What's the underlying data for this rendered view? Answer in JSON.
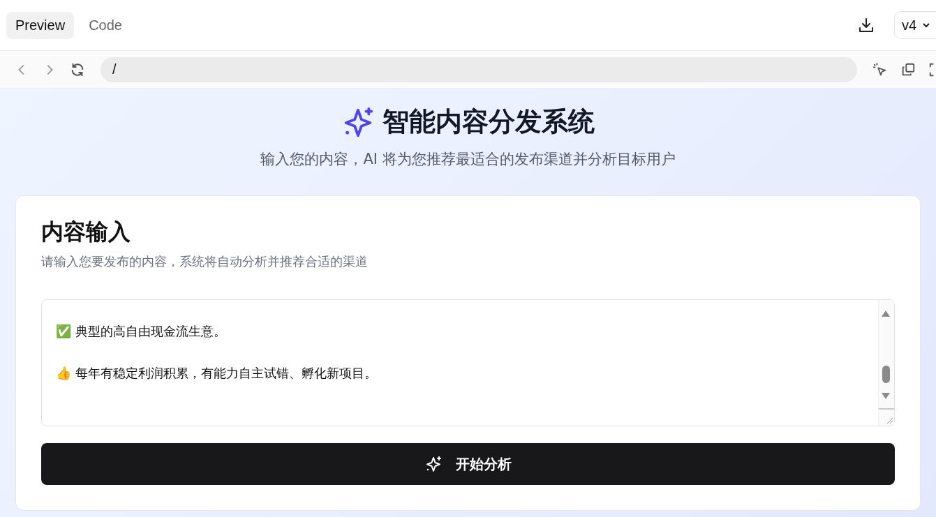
{
  "tabs": [
    {
      "label": "Preview",
      "selected": true
    },
    {
      "label": "Code",
      "selected": false
    }
  ],
  "version": {
    "value": "v4"
  },
  "address_bar": {
    "value": "/"
  },
  "header": {
    "title": "智能内容分发系统",
    "subtitle": "输入您的内容，AI 将为您推荐最适合的发布渠道并分析目标用户"
  },
  "card": {
    "title": "内容输入",
    "description": "请输入您要发布的内容，系统将自动分析并推荐合适的渠道",
    "content_lines": [
      {
        "kind": "text",
        "text": "✅ 典型的高自由现金流生意。"
      },
      {
        "kind": "blank"
      },
      {
        "kind": "text",
        "text": "👍 每年有稳定利润积累，有能力自主试错、孵化新项目。"
      }
    ],
    "button": {
      "label": "开始分析"
    }
  }
}
